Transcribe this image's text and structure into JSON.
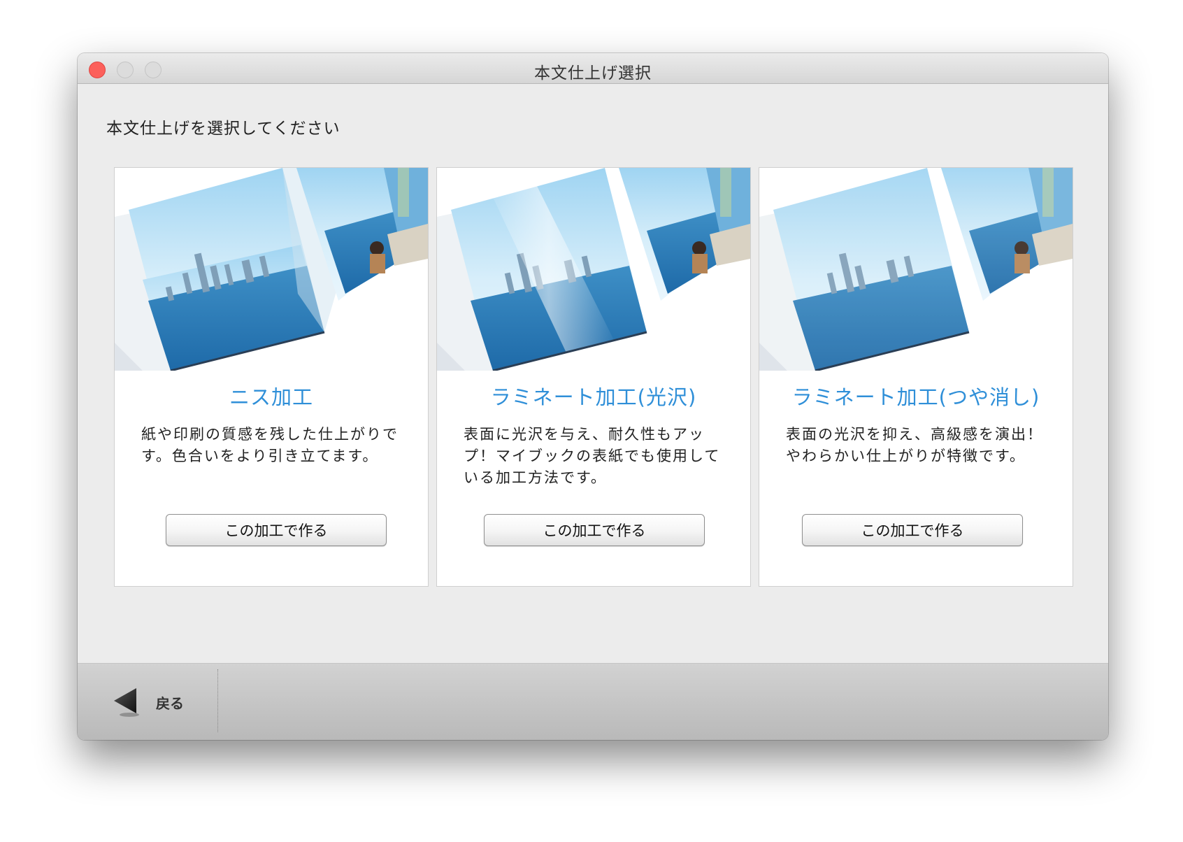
{
  "window": {
    "title": "本文仕上げ選択"
  },
  "prompt": "本文仕上げを選択してください",
  "options": [
    {
      "title": "ニス加工",
      "description": "紙や印刷の質感を残した仕上がりです。色合いをより引き立てます。",
      "button_label": "この加工で作る"
    },
    {
      "title": "ラミネート加工(光沢)",
      "description": "表面に光沢を与え、耐久性もアップ！マイブックの表紙でも使用している加工方法です。",
      "button_label": "この加工で作る"
    },
    {
      "title": "ラミネート加工(つや消し)",
      "description": "表面の光沢を抑え、高級感を演出！やわらかい仕上がりが特徴です。",
      "button_label": "この加工で作る"
    }
  ],
  "footer": {
    "back_label": "戻る"
  },
  "colors": {
    "accent": "#2f8fd8",
    "close_button": "#fc605b"
  },
  "icons": {
    "back": "back-triangle-icon"
  }
}
